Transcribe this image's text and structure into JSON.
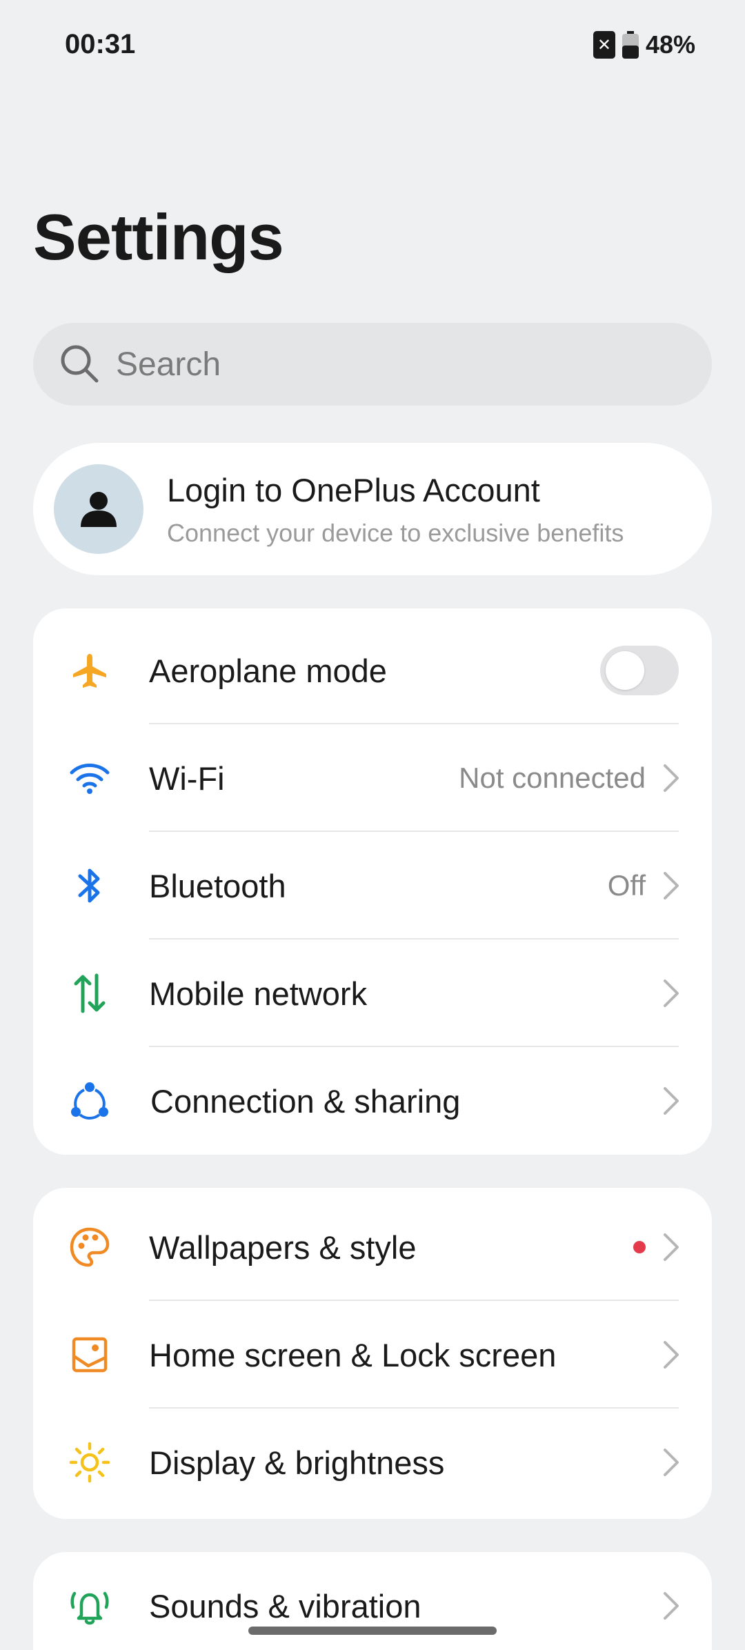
{
  "status": {
    "time": "00:31",
    "battery": "48%"
  },
  "page": {
    "title": "Settings"
  },
  "search": {
    "placeholder": "Search"
  },
  "account": {
    "title": "Login to OnePlus Account",
    "subtitle": "Connect your device to exclusive benefits"
  },
  "connectivity": {
    "aeroplane": {
      "label": "Aeroplane mode",
      "toggle_on": false,
      "icon": "airplane-icon",
      "color": "#f5a623"
    },
    "wifi": {
      "label": "Wi-Fi",
      "value": "Not connected",
      "icon": "wifi-icon",
      "color": "#1a73e8"
    },
    "bluetooth": {
      "label": "Bluetooth",
      "value": "Off",
      "icon": "bluetooth-icon",
      "color": "#1a73e8"
    },
    "mobile": {
      "label": "Mobile network",
      "icon": "mobile-data-icon",
      "color": "#22a35a"
    },
    "connection": {
      "label": "Connection & sharing",
      "icon": "share-network-icon",
      "color": "#1a73e8"
    }
  },
  "personalization": {
    "wallpapers": {
      "label": "Wallpapers & style",
      "icon": "palette-icon",
      "color": "#f08a24",
      "has_dot": true
    },
    "homescreen": {
      "label": "Home screen & Lock screen",
      "icon": "home-screen-icon",
      "color": "#f08a24"
    },
    "display": {
      "label": "Display & brightness",
      "icon": "brightness-icon",
      "color": "#f5c21b"
    }
  },
  "sound": {
    "sounds": {
      "label": "Sounds & vibration",
      "icon": "bell-icon",
      "color": "#22a35a"
    }
  }
}
